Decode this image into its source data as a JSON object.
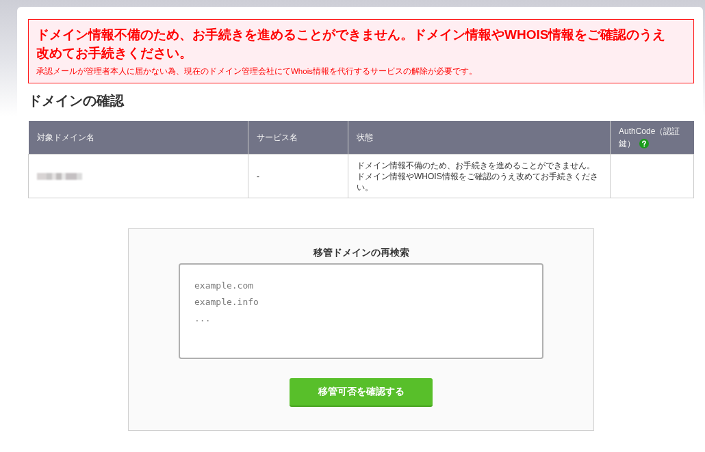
{
  "alert": {
    "title": "ドメイン情報不備のため、お手続きを進めることができません。ドメイン情報やWHOIS情報をご確認のうえ改めてお手続きください。",
    "detail": "承認メールが管理者本人に届かない為、現在のドメイン管理会社にてWhois情報を代行するサービスの解除が必要です。"
  },
  "section_title": "ドメインの確認",
  "table": {
    "columns": [
      {
        "label": "対象ドメイン名",
        "help": false
      },
      {
        "label": "サービス名",
        "help": false
      },
      {
        "label": "状態",
        "help": false
      },
      {
        "label": "AuthCode（認証鍵）",
        "help": true
      }
    ],
    "rows": [
      {
        "cells": [
          {
            "kind": "redacted"
          },
          {
            "kind": "text",
            "text": "-"
          },
          {
            "kind": "text",
            "text": "ドメイン情報不備のため、お手続きを進めることができません。ドメイン情報やWHOIS情報をご確認のうえ改めてお手続きください。"
          }
        ]
      }
    ]
  },
  "search": {
    "title": "移管ドメインの再検索",
    "placeholder": "example.com\nexample.info\n...",
    "button": "移管可否を確認する"
  }
}
